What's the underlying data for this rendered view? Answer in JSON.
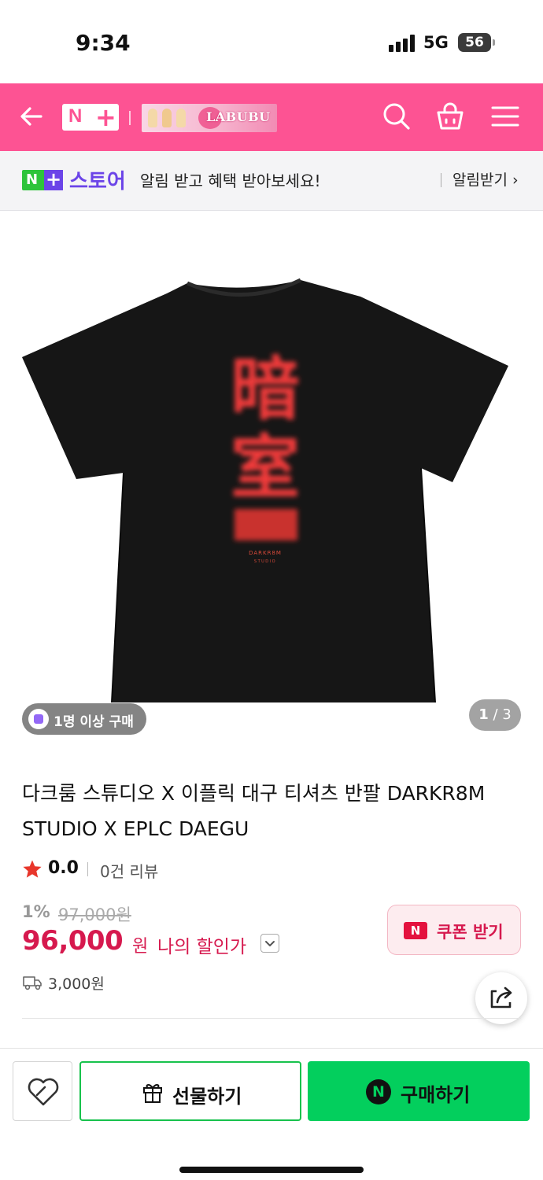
{
  "status_bar": {
    "time": "9:34",
    "network": "5G",
    "battery": "56"
  },
  "header": {
    "logo_n": "N",
    "logo_plus": "+",
    "banner_text": "LABUBU",
    "bg_color": "#fd5393"
  },
  "store_bar": {
    "logo_n": "N",
    "logo_plus": "+",
    "store_name": "스토어",
    "message": "알림 받고 혜택 받아보세요!",
    "alert_label": "알림받기 ›"
  },
  "product": {
    "buyer_badge": "1명 이상 구매",
    "page_current": "1",
    "page_total": " / 3",
    "title": "다크룸 스튜디오 X 이플릭 대구 티셔츠 반팔 DARKR8M STUDIO X EPLC DAEGU",
    "rating": "0.0",
    "review_count": "0건 리뷰",
    "discount_rate": "1%",
    "original_price": "97,000원",
    "price": "96,000",
    "price_unit": "원",
    "my_price_label": "나의 할인가",
    "coupon_logo": "N",
    "coupon_label": "쿠폰 받기",
    "shipping_fee": "3,000원",
    "shirt_print": {
      "line1": "暗",
      "line2": "室",
      "brand": "DARKR8M",
      "sub": "STUDIO"
    }
  },
  "bottom_bar": {
    "gift_label": "선물하기",
    "buy_logo": "N",
    "buy_label": "구매하기"
  },
  "colors": {
    "accent_pink": "#fd5393",
    "price_red": "#d6194e",
    "naver_green": "#03cf5d",
    "store_purple": "#6b44e8"
  }
}
